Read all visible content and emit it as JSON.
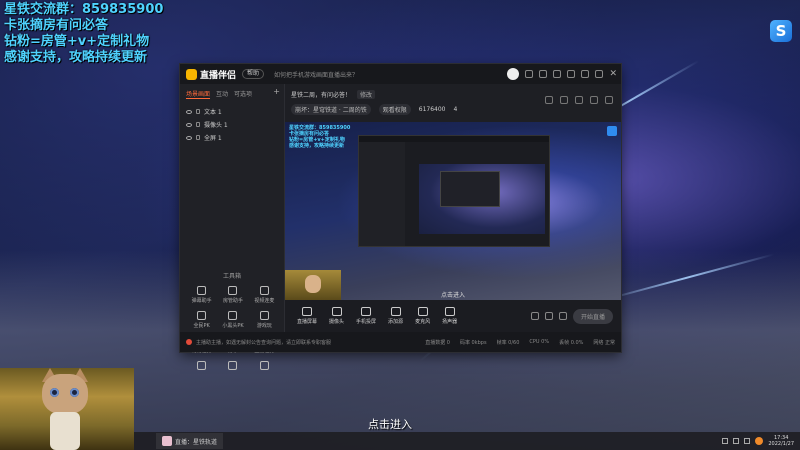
{
  "overlay": {
    "line1": "星铁交流群：859835900",
    "line2": "卡张摘房有问必答",
    "line3": "钻粉=房管+v+定制礼物",
    "line4": "感谢支持，攻略持续更新"
  },
  "corner_logo": "S",
  "app": {
    "name": "直播伴侣",
    "version_pill": "帮助",
    "title_message": "如何把手机游戏画面直播出来？",
    "stream": {
      "title": "星铁二周，有问必答！",
      "edit_label": "修改",
      "category": "崩坏：星穹铁道 · 二周的铁",
      "room_settings": "观看权限",
      "viewer_count": "6176400",
      "likes": "4"
    },
    "left_tabs": [
      "场景画面",
      "互动",
      "可选项"
    ],
    "sources": [
      "文本 1",
      "摄像头 1",
      "全屏 1"
    ],
    "tools_title": "工具箱",
    "tools": [
      "弹幕助手",
      "房管助手",
      "视频连麦",
      "全民PK",
      "小黑头PK",
      "游戏玩",
      "礼物任务",
      "分享",
      "直播任务",
      "",
      "",
      ""
    ],
    "preview_overlay": [
      "星铁交流群：859835900",
      "卡张摘房有问必答",
      "钻粉=房管+v+定制礼物",
      "感谢支持，攻略持续更新"
    ],
    "enter_hint": "点击进入",
    "controls": [
      "直播屏幕",
      "摄像头",
      "手机投屏",
      "添加源",
      "麦克风",
      "扬声器"
    ],
    "go_live": "开始直播",
    "status_message": "主播助主播，如遇无解封公告查询问题，请立即联系专职客服",
    "status_right": [
      "直播数据 0",
      "码率 0kbps",
      "帧率 0/60",
      "CPU 0%",
      "丢帧 0.0%",
      "网络 正常"
    ]
  },
  "subtitle": "点击进入",
  "taskbar": {
    "app_label": "直播：星铁轨道",
    "time": "17:34",
    "date": "2022/1/27"
  }
}
